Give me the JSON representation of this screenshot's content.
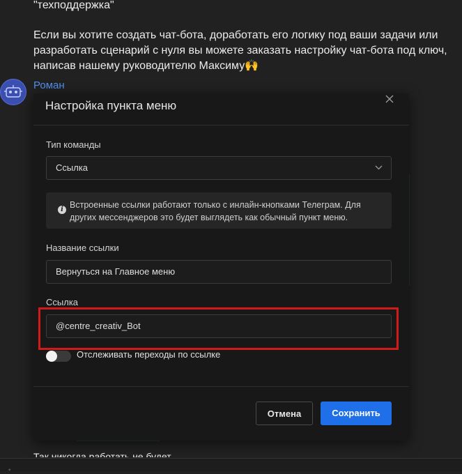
{
  "chat": {
    "quote_line": "\"техподдержка\"",
    "paragraph_lines": [
      "Если вы хотите создать чат-бота, доработать его логику под ваши задачи или",
      "разработать сценарий с нуля вы можете заказать настройку чат-бота под ключ,",
      "написав нашему руководителю Максиму🙌"
    ],
    "author": "Роман",
    "reply_text": "Так никогда работать не будет",
    "avatar_icon": "robot-avatar-icon"
  },
  "modal": {
    "title": "Настройка пункта меню",
    "close_icon": "close-icon",
    "command_type_label": "Тип команды",
    "command_type_value": "Ссылка",
    "info_icon": "info-icon",
    "info_text": "Встроенные ссылки работают только с инлайн-кнопками Телеграм. Для других мессенджеров это будет выглядеть как обычный пункт меню.",
    "link_name_label": "Название ссылки",
    "link_name_value": "Вернуться на Главное меню",
    "link_label": "Ссылка",
    "link_value": "@centre_creativ_Bot",
    "track_toggle_label": "Отслеживать переходы по ссылке",
    "track_toggle_on": false,
    "cancel_label": "Отмена",
    "save_label": "Сохранить"
  },
  "colors": {
    "background": "#212121",
    "modal_bg": "#181818",
    "accent_blue": "#1f6fe8",
    "author_link": "#4f8fef",
    "highlight_red": "#d11a1a"
  }
}
